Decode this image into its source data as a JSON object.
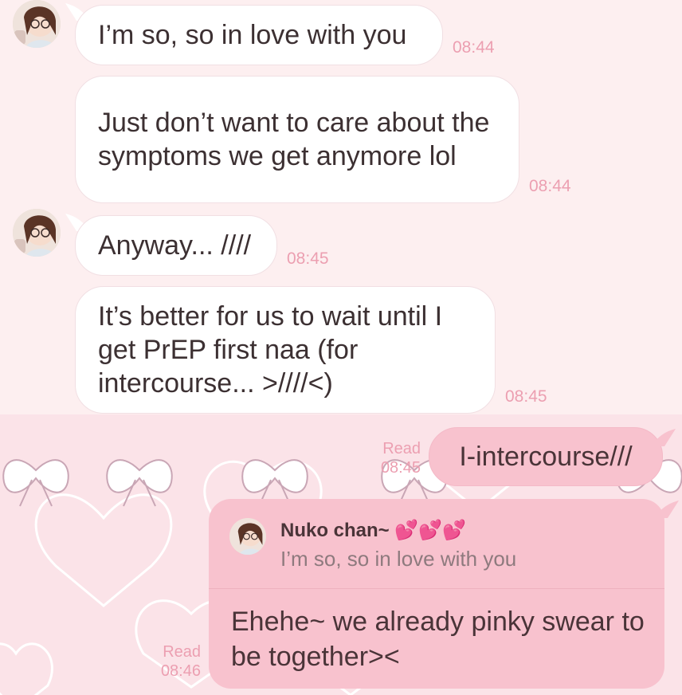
{
  "contact": {
    "name": "Nuko chan~ 💕💕💕"
  },
  "messages": [
    {
      "id": "m1",
      "text": "I’m so, so in love with you",
      "time": "08:44"
    },
    {
      "id": "m2",
      "text": "Just don’t want to care about the symptoms we get anymore lol",
      "time": "08:44"
    },
    {
      "id": "m3",
      "text": "Anyway... ////",
      "time": "08:45"
    },
    {
      "id": "m4",
      "text": "It’s better for us to wait until I get PrEP first naa (for intercourse... >////<)",
      "time": "08:45"
    },
    {
      "id": "m5",
      "text": "I-intercourse///",
      "status": "Read",
      "time": "08:45"
    },
    {
      "id": "m6",
      "text": "Ehehe~ we already pinky swear to be together><",
      "status": "Read",
      "time": "08:46",
      "reply_to": {
        "name": "Nuko chan~ 💕💕💕",
        "text": "I’m so, so in love with you"
      }
    }
  ],
  "colors": {
    "incoming_bubble": "#ffffff",
    "outgoing_bubble": "#f8c2ce",
    "time_text": "#ec9fb1",
    "background": "#fdeff0"
  },
  "icons": {
    "avatar": "contact-avatar-photo",
    "background": "bow-and-heart-pattern"
  }
}
